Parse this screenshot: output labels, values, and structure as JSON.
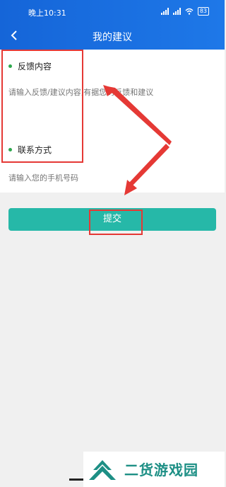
{
  "status": {
    "time": "晚上10:31",
    "battery": "83"
  },
  "header": {
    "title": "我的建议"
  },
  "feedback": {
    "label": "反馈内容",
    "placeholder": "请输入反馈/建议内容,有据您的反馈和建议"
  },
  "contact": {
    "label": "联系方式",
    "placeholder": "请输入您的手机号码"
  },
  "submit_label": "提交",
  "watermark": {
    "text": "二货游戏园"
  },
  "colors": {
    "header": "#1e78e8",
    "submit": "#26b8a8",
    "highlight": "#e53935",
    "dot": "#2da84d"
  }
}
